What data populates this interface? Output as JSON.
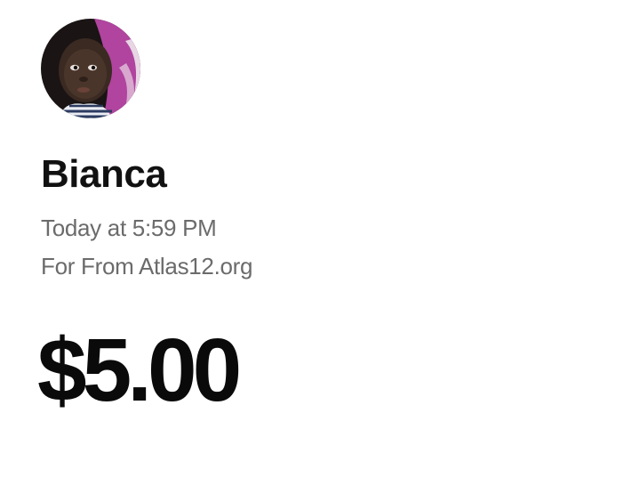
{
  "payment": {
    "sender_name": "Bianca",
    "timestamp": "Today at 5:59 PM",
    "note": "For From Atlas12.org",
    "amount": "$5.00"
  },
  "colors": {
    "primary_text": "#111111",
    "secondary_text": "#6b6b6b",
    "background": "#ffffff"
  }
}
